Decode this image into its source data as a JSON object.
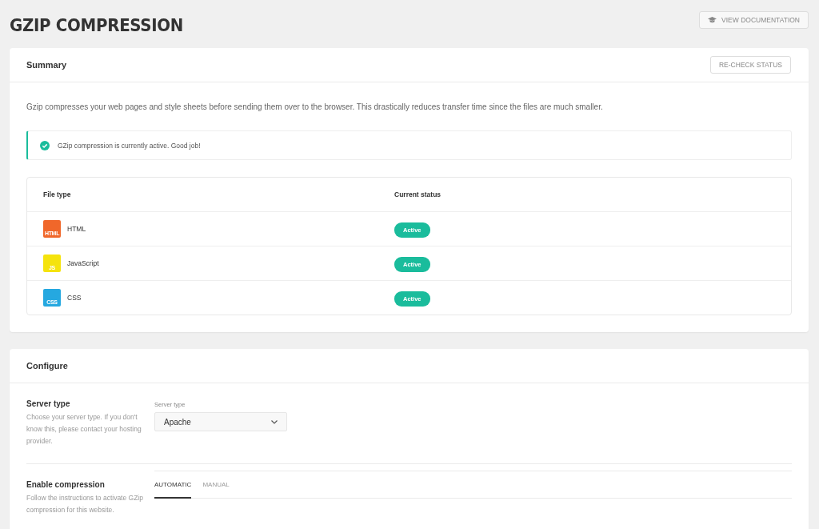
{
  "page": {
    "title": "GZIP COMPRESSION",
    "doc_button": "VIEW DOCUMENTATION"
  },
  "summary": {
    "title": "Summary",
    "recheck_button": "RE-CHECK STATUS",
    "description": "Gzip compresses your web pages and style sheets before sending them over to the browser. This drastically reduces transfer time since the files are much smaller.",
    "notice": "GZip compression is currently active. Good job!",
    "table": {
      "columns": [
        "File type",
        "Current status"
      ],
      "rows": [
        {
          "icon_label": "HTML",
          "color": "#f0672a",
          "name": "HTML",
          "status": "Active"
        },
        {
          "icon_label": "JS",
          "color": "#f5e30d",
          "name": "JavaScript",
          "status": "Active"
        },
        {
          "icon_label": "CSS",
          "color": "#25a8e0",
          "name": "CSS",
          "status": "Active"
        }
      ]
    }
  },
  "configure": {
    "title": "Configure",
    "sections": [
      {
        "kind": "select",
        "title": "Server type",
        "description": "Choose your server type. If you don't know this, please contact your hosting provider.",
        "field_label": "Server type",
        "value": "Apache"
      },
      {
        "kind": "tabs",
        "title": "Enable compression",
        "description": "Follow the instructions to activate GZip compression for this website.",
        "tabs": [
          {
            "label": "AUTOMATIC",
            "selected": true
          },
          {
            "label": "MANUAL",
            "selected": false
          }
        ]
      }
    ]
  }
}
